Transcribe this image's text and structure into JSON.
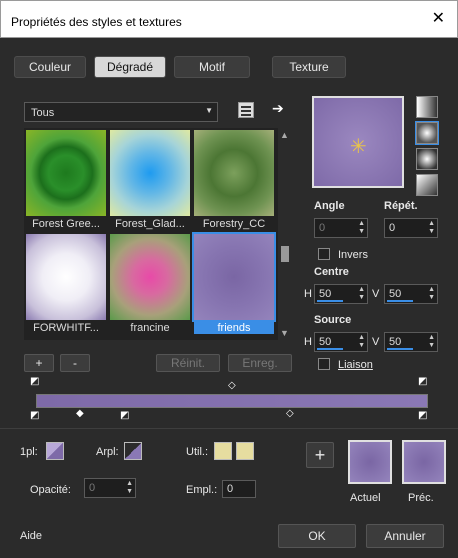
{
  "window": {
    "title": "Propriétés des styles et textures",
    "close_icon": "close-icon"
  },
  "tabs": [
    {
      "label": "Couleur",
      "active": false
    },
    {
      "label": "Dégradé",
      "active": true
    },
    {
      "label": "Motif",
      "active": false
    },
    {
      "label": "Texture",
      "active": false
    }
  ],
  "category": {
    "value": "Tous"
  },
  "gallery": {
    "items": [
      {
        "label": "Forest Gree..."
      },
      {
        "label": "Forest_Glad..."
      },
      {
        "label": "Forestry_CC"
      },
      {
        "label": "FORWHITF..."
      },
      {
        "label": "francine"
      },
      {
        "label": "friends",
        "selected": true
      }
    ]
  },
  "gradient_buttons": {
    "add": "+",
    "remove": "-",
    "reset": "Réinit.",
    "save": "Enreg."
  },
  "controls": {
    "angle_label": "Angle",
    "angle_value": "0",
    "repeat_label": "Répét.",
    "repeat_value": "0",
    "invert_label": "Invers",
    "center_label": "Centre",
    "center_h_label": "H",
    "center_h": "50",
    "center_v_label": "V",
    "center_v": "50",
    "source_label": "Source",
    "source_h_label": "H",
    "source_h": "50",
    "source_v_label": "V",
    "source_v": "50",
    "link_label": "Liaison"
  },
  "bottom": {
    "fg_label": "1pl:",
    "bg_label": "Arpl:",
    "user_label": "Util.:",
    "opacity_label": "Opacité:",
    "opacity_value": "0",
    "location_label": "Empl.:",
    "location_value": "0",
    "current_label": "Actuel",
    "previous_label": "Préc."
  },
  "footer": {
    "help": "Aide",
    "ok": "OK",
    "cancel": "Annuler"
  },
  "colors": {
    "accent": "#3a8ee6",
    "gradient_start": "#7e6aa8",
    "gradient_end": "#8a78b5"
  }
}
